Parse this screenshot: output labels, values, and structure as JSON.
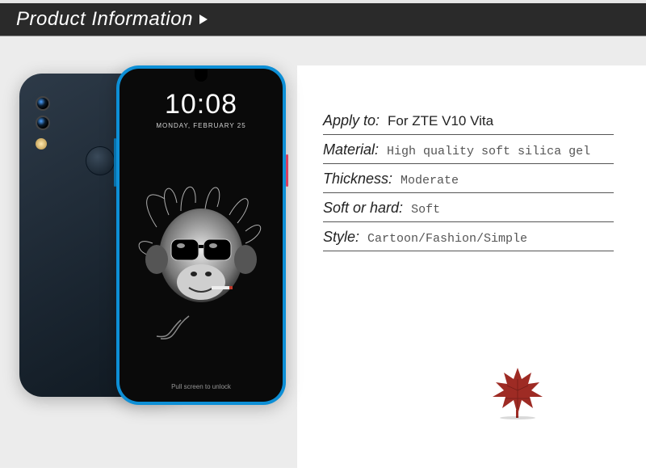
{
  "header": {
    "title": "Product Information"
  },
  "phone_display": {
    "time": "10:08",
    "date": "MONDAY, FEBRUARY 25",
    "unlock_hint": "Pull screen to unlock"
  },
  "specs": {
    "apply_to": {
      "label": "Apply to:",
      "value": "For ZTE V10 Vita"
    },
    "material": {
      "label": "Material:",
      "value": "High quality soft silica gel"
    },
    "thickness": {
      "label": "Thickness:",
      "value": "Moderate"
    },
    "soft_or_hard": {
      "label": "Soft or hard:",
      "value": "Soft"
    },
    "style": {
      "label": "Style:",
      "value": "Cartoon/Fashion/Simple"
    }
  }
}
